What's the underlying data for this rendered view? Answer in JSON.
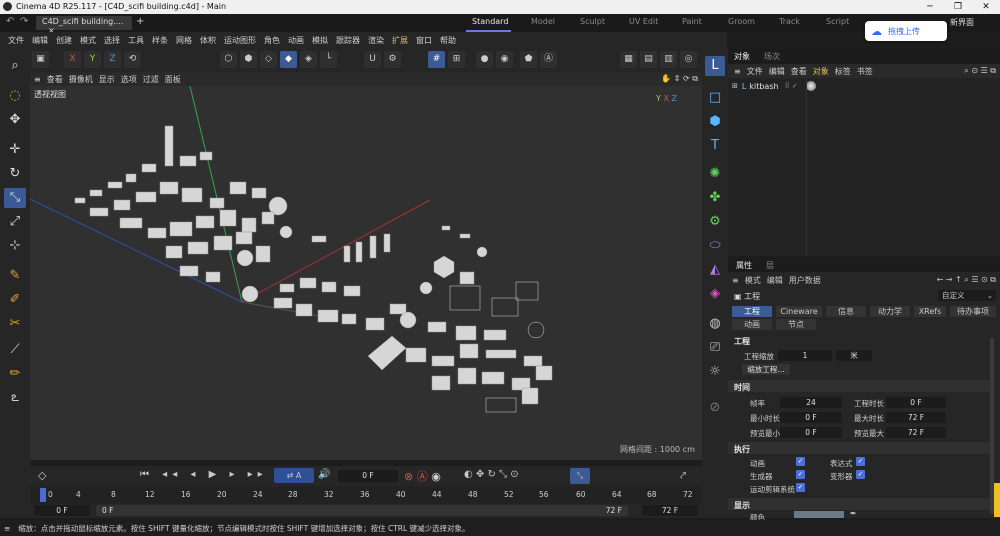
{
  "window": {
    "title": "Cinema 4D R25.117 - [C4D_scifi building.c4d] - Main"
  },
  "tabs": {
    "doc_tab": "C4D_scifi building....",
    "new_tab": "+"
  },
  "layouts": [
    "Standard",
    "Model",
    "Sculpt",
    "UV Edit",
    "Paint",
    "Groom",
    "Track",
    "Script"
  ],
  "popup": {
    "label": "拖拽上传"
  },
  "new_ui_label": "新界面",
  "menu": [
    "文件",
    "编辑",
    "创建",
    "模式",
    "选择",
    "工具",
    "样条",
    "网格",
    "体积",
    "运动图形",
    "角色",
    "动画",
    "模拟",
    "跟踪器",
    "渲染",
    "扩展",
    "窗口",
    "帮助"
  ],
  "viewport_menu": [
    "查看",
    "摄像机",
    "显示",
    "选项",
    "过滤",
    "面板"
  ],
  "viewport": {
    "label": "透视视图",
    "grid": "网格间距 : 1000 cm"
  },
  "toolbar_icons": [
    "cube-icon",
    "axis-x-icon",
    "axis-y-icon",
    "axis-z-icon",
    "coord-icon",
    "point-mode-icon",
    "edge-mode-icon",
    "poly-mode-icon",
    "model-mode-icon",
    "snap-icon",
    "workplane-icon",
    "grid-icon",
    "render-view-icon",
    "render-settings-icon"
  ],
  "toolbar_letters": {
    "x": "X",
    "y": "Y",
    "z": "Z"
  },
  "object_manager": {
    "tabs": [
      "对象",
      "场次"
    ],
    "menu": [
      "文件",
      "编辑",
      "查看",
      "对象",
      "标签",
      "书签"
    ],
    "objects": [
      {
        "name": "kitbash"
      }
    ]
  },
  "attributes": {
    "tabs": [
      "属性",
      "层"
    ],
    "menu": [
      "模式",
      "编辑",
      "用户数据"
    ],
    "title": "工程",
    "preset": "自定义",
    "subtabs_row1": [
      "工程",
      "Cineware",
      "信息",
      "动力学",
      "XRefs",
      "待办事项"
    ],
    "subtabs_row2": [
      "动画",
      "节点"
    ],
    "section_project": "工程",
    "scale_label": "工程缩放",
    "scale_value": "1",
    "scale_unit": "米",
    "scale_button": "缩放工程...",
    "section_time": "时间",
    "fps_label": "帧率",
    "fps_value": "24",
    "length_label": "工程时长",
    "length_value": "0 F",
    "min_label": "最小时长",
    "min_value": "0 F",
    "max_label": "最大时长",
    "max_value": "72 F",
    "pmin_label": "预览最小",
    "pmin_value": "0 F",
    "pmax_label": "预览最大",
    "pmax_value": "72 F",
    "section_exec": "执行",
    "anim_label": "动画",
    "expr_label": "表达式",
    "gen_label": "生成器",
    "deform_label": "变形器",
    "motion_label": "运动剪辑系统",
    "section_display": "显示",
    "color_label": "颜色"
  },
  "timeline": {
    "current_frame": "0 F",
    "ruler": [
      "0",
      "4",
      "8",
      "12",
      "16",
      "20",
      "24",
      "28",
      "32",
      "36",
      "40",
      "44",
      "48",
      "52",
      "56",
      "60",
      "64",
      "68",
      "72"
    ],
    "start": "0 F",
    "start2": "0 F",
    "end": "72 F",
    "end2": "72 F"
  },
  "status": "缩放：点击并拖动鼠标缩放元素。按住 SHIFT 键量化缩放；节点编辑模式时按住 SHIFT 键增加选择对象；按住 CTRL 键减少选择对象。"
}
